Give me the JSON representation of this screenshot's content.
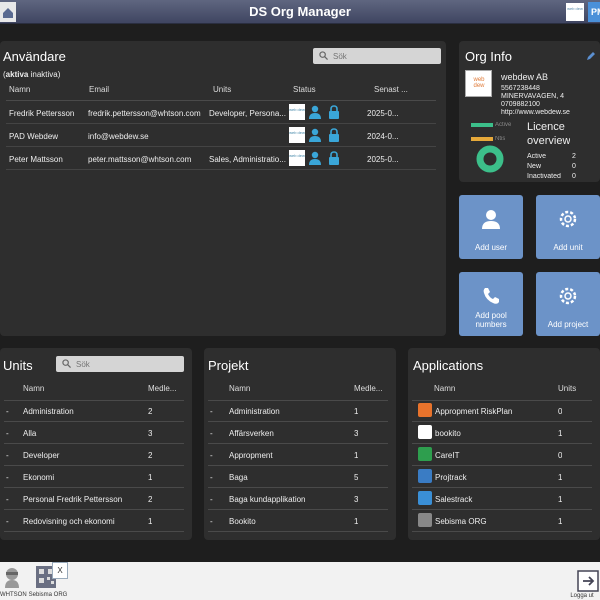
{
  "app": {
    "title": "DS Org Manager",
    "user_initials": "PM",
    "logo_text": "web dew"
  },
  "users": {
    "title": "Användare",
    "filter_active": "aktiva",
    "filter_inactive": "inaktiva",
    "search_placeholder": "Sök",
    "columns": [
      "Namn",
      "Email",
      "Units",
      "Status",
      "Senast ..."
    ],
    "rows": [
      {
        "name": "Fredrik Pettersson",
        "email": "fredrik.pettersson@whtson.com",
        "units": "Developer, Persona...",
        "last": "2025-0..."
      },
      {
        "name": "PAD Webdew",
        "email": "info@webdew.se",
        "units": "",
        "last": "2024-0..."
      },
      {
        "name": "Peter Mattsson",
        "email": "peter.mattsson@whtson.com",
        "units": "Sales, Administratio...",
        "last": "2025-0..."
      }
    ]
  },
  "org": {
    "title": "Org Info",
    "name": "webdew AB",
    "orgnr": "5567238448",
    "address": "MINERVAVÄGEN, 4",
    "phone": "0709882100",
    "url": "http://www.webdew.se",
    "legend_active": "Active",
    "legend_new": "Ntis",
    "licence_title_1": "Licence",
    "licence_title_2": "overview",
    "stats": [
      {
        "label": "Active",
        "value": "2"
      },
      {
        "label": "New",
        "value": "0"
      },
      {
        "label": "Inactivated",
        "value": "0"
      }
    ],
    "colors": {
      "active": "#3cbf8a",
      "new": "#e6a93a"
    }
  },
  "actions": {
    "add_user": "Add user",
    "add_unit": "Add unit",
    "add_pool_numbers": "Add pool numbers",
    "add_project": "Add project"
  },
  "units": {
    "title": "Units",
    "search_placeholder": "Sök",
    "columns": [
      "Namn",
      "Medle..."
    ],
    "rows": [
      {
        "name": "Administration",
        "count": "2"
      },
      {
        "name": "Alla",
        "count": "3"
      },
      {
        "name": "Developer",
        "count": "2"
      },
      {
        "name": "Ekonomi",
        "count": "1"
      },
      {
        "name": "Personal Fredrik Pettersson",
        "count": "2"
      },
      {
        "name": "Redovisning och ekonomi",
        "count": "1"
      }
    ]
  },
  "projects": {
    "title": "Projekt",
    "columns": [
      "Namn",
      "Medle..."
    ],
    "rows": [
      {
        "name": "Administration",
        "count": "1"
      },
      {
        "name": "Affärsverken",
        "count": "3"
      },
      {
        "name": "Appropment",
        "count": "1"
      },
      {
        "name": "Baga",
        "count": "5"
      },
      {
        "name": "Baga kundapplikation",
        "count": "3"
      },
      {
        "name": "Bookito",
        "count": "1"
      }
    ]
  },
  "applications": {
    "title": "Applications",
    "columns": [
      "Namn",
      "Units"
    ],
    "rows": [
      {
        "name": "Appropment RiskPlan",
        "count": "0",
        "color": "#e8732c"
      },
      {
        "name": "bookito",
        "count": "1",
        "color": "#ffffff"
      },
      {
        "name": "CareIT",
        "count": "0",
        "color": "#2e9e4e"
      },
      {
        "name": "Projtrack",
        "count": "1",
        "color": "#3a7cc4"
      },
      {
        "name": "Salestrack",
        "count": "1",
        "color": "#3a8fd6"
      },
      {
        "name": "Sebisma ORG",
        "count": "1",
        "color": "#888888"
      }
    ]
  },
  "bottom": {
    "whtson": "WHTSON",
    "sebisma": "Sebisma ORG",
    "close": "X",
    "logout": "Logga ut"
  }
}
